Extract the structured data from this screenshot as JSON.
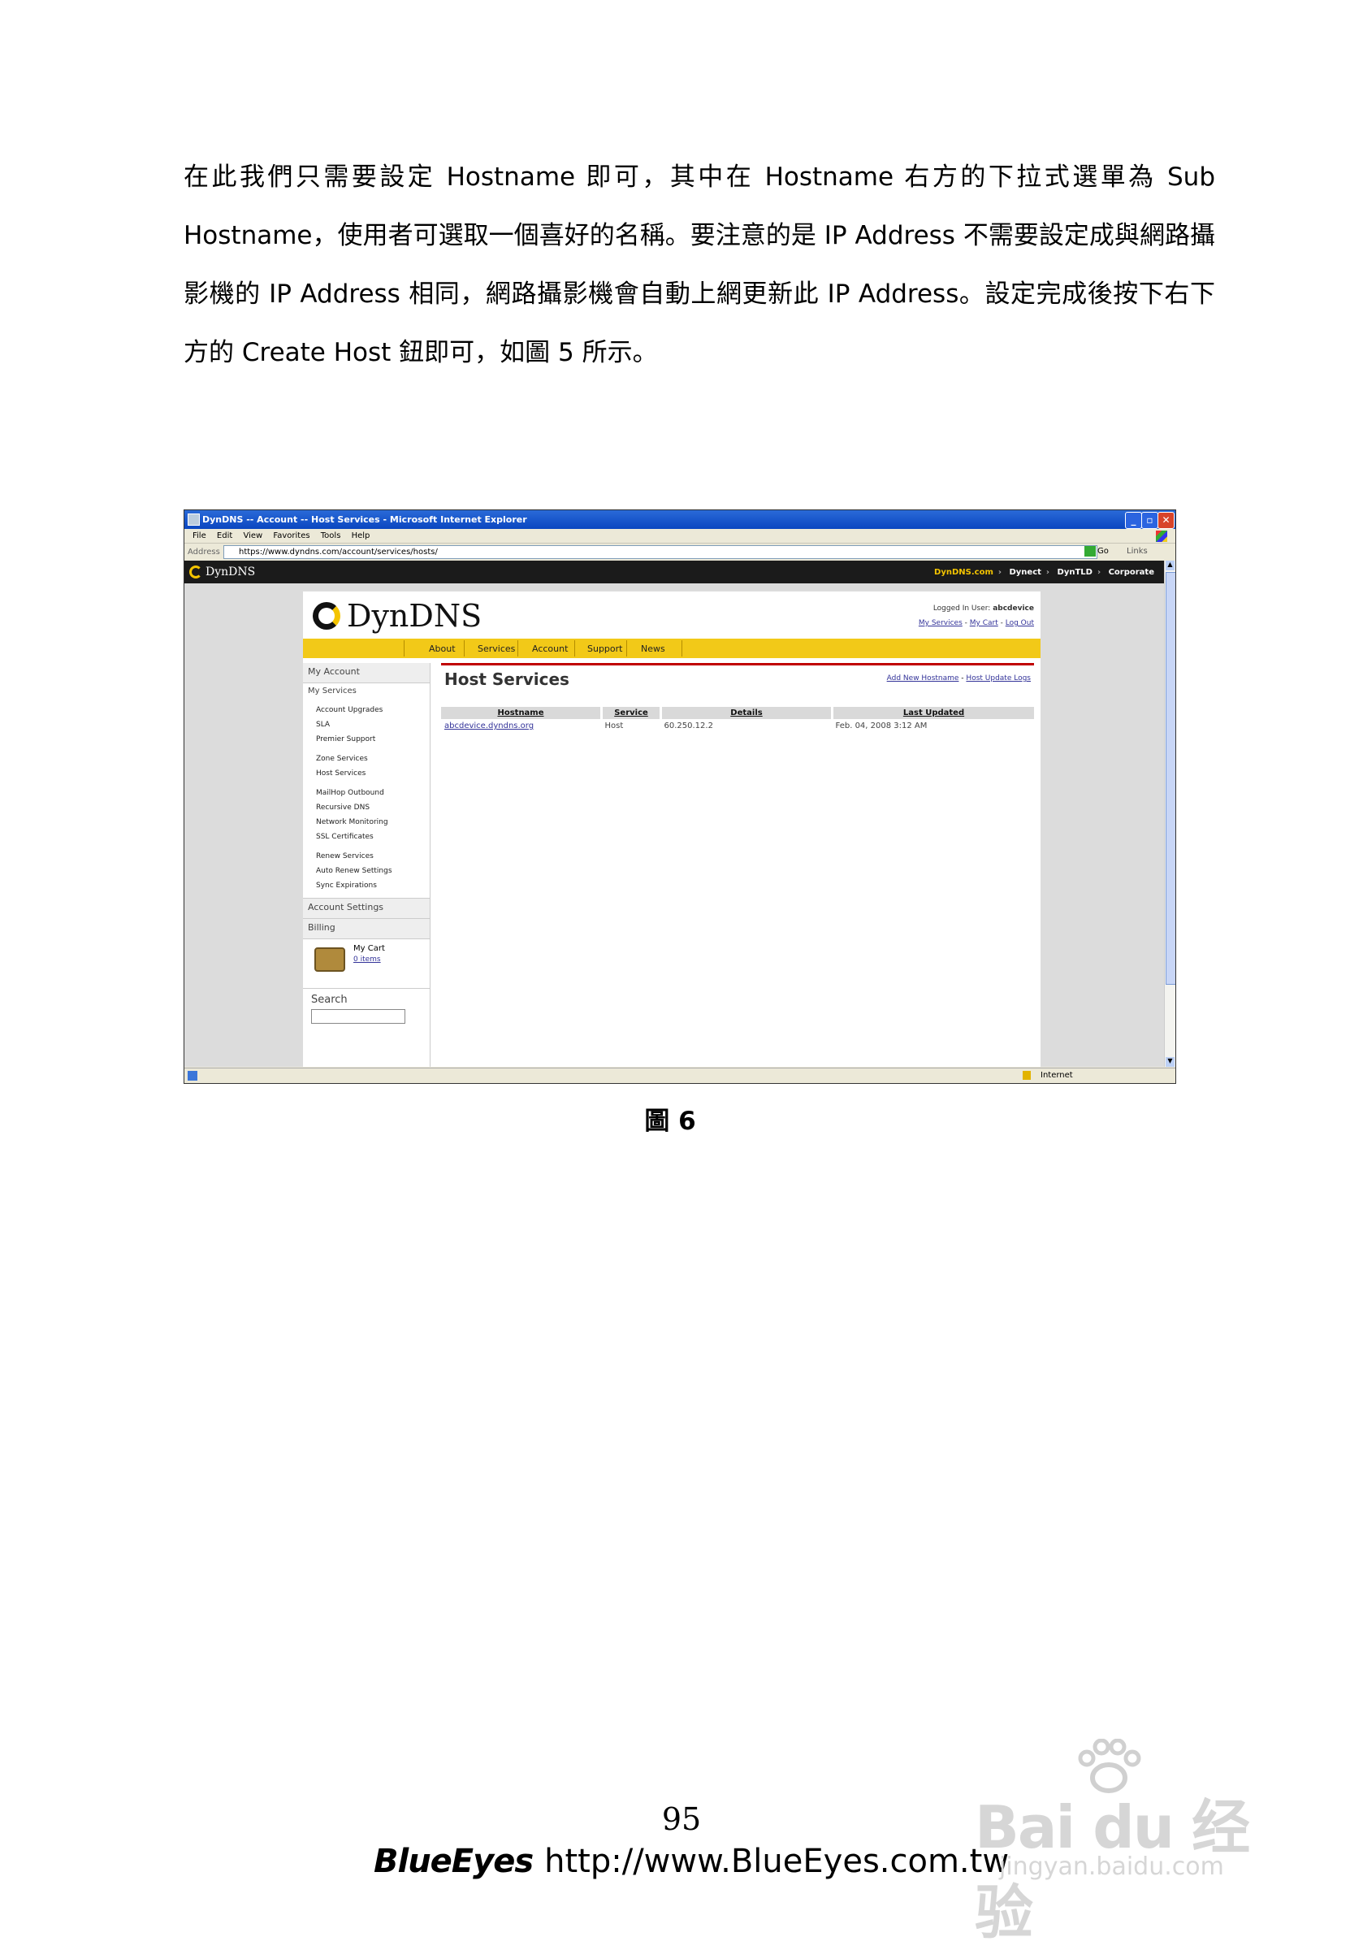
{
  "document": {
    "paragraph_lines": [
      "在此我們只需要設定 Hostname 即可，其中在 Hostname 右方的下拉式選單為 Sub",
      "Hostname，使用者可選取一個喜好的名稱。要注意的是 IP Address 不需要設定成與網路攝",
      "影機的 IP Address 相同，網路攝影機會自動上網更新此 IP Address。設定完成後按下右下",
      "方的 Create Host 鈕即可，如圖 5 所示。"
    ],
    "figure_caption": "圖 6",
    "page_number": "95",
    "footer_brand": "BlueEyes",
    "footer_url": "http://www.BlueEyes.com.tw",
    "watermark_logo": "Bai du 经验",
    "watermark_url": "jingyan.baidu.com"
  },
  "browser": {
    "window_title": "DynDNS -- Account -- Host Services - Microsoft Internet Explorer",
    "menu": [
      "File",
      "Edit",
      "View",
      "Favorites",
      "Tools",
      "Help"
    ],
    "address_label": "Address",
    "address_value": "https://www.dyndns.com/account/services/hosts/",
    "go_label": "Go",
    "links_label": "Links",
    "status_zone": "Internet"
  },
  "site": {
    "top_logo": "DynDNS",
    "top_nav": [
      "DynDNS.com",
      "Dynect",
      "DynTLD",
      "Corporate"
    ],
    "logo": "DynDNS",
    "logged_in_label": "Logged In User:",
    "logged_in_user": "abcdevice",
    "user_links": [
      "My Services",
      "My Cart",
      "Log Out"
    ],
    "tabs": [
      "About",
      "Services",
      "Account",
      "Support",
      "News"
    ],
    "sidebar": {
      "my_account": "My Account",
      "my_services": "My Services",
      "groups": [
        [
          "Account Upgrades",
          "SLA",
          "Premier Support"
        ],
        [
          "Zone Services",
          "Host Services"
        ],
        [
          "MailHop Outbound",
          "Recursive DNS",
          "Network Monitoring",
          "SSL Certificates"
        ],
        [
          "Renew Services",
          "Auto Renew Settings",
          "Sync Expirations"
        ]
      ],
      "account_settings": "Account Settings",
      "billing": "Billing",
      "cart_title": "My Cart",
      "cart_items": "0 items",
      "search": "Search"
    },
    "main": {
      "title": "Host Services",
      "links": [
        "Add New Hostname",
        "Host Update Logs"
      ],
      "columns": [
        "Hostname",
        "Service",
        "Details",
        "Last Updated"
      ],
      "rows": [
        [
          "abcdevice.dyndns.org",
          "Host",
          "60.250.12.2",
          "Feb. 04, 2008 3:12 AM"
        ]
      ]
    }
  }
}
